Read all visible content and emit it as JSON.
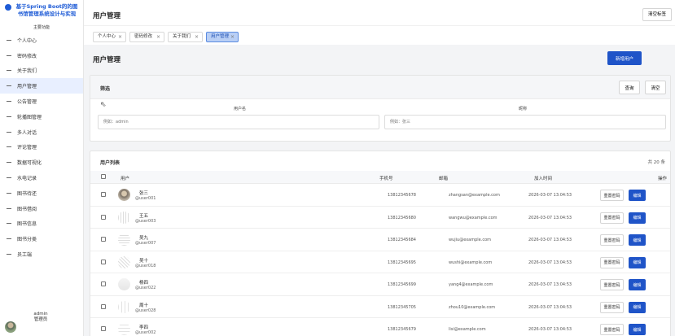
{
  "sidebar": {
    "brand": "基于Spring Boot的的图书馆管理系统设计与实现",
    "section_title": "主要功能",
    "items": [
      {
        "label": "个人中心"
      },
      {
        "label": "密码修改"
      },
      {
        "label": "关于我们"
      },
      {
        "label": "用户管理"
      },
      {
        "label": "公告管理"
      },
      {
        "label": "轮播图管理"
      },
      {
        "label": "多人对话"
      },
      {
        "label": "评论管理"
      },
      {
        "label": "数据可视化"
      },
      {
        "label": "水电记录"
      },
      {
        "label": "图书待还"
      },
      {
        "label": "图书借阅"
      },
      {
        "label": "图书信息"
      },
      {
        "label": "图书分类"
      },
      {
        "label": "员工端"
      }
    ],
    "active_index": 3,
    "user": {
      "name": "admin",
      "role": "管理员"
    }
  },
  "topbar": {
    "title": "用户管理",
    "close_tabs_label": "清空标签"
  },
  "tabs": [
    {
      "label": "个人中心",
      "close": "×"
    },
    {
      "label": "密码修改",
      "close": "×"
    },
    {
      "label": "关于我们",
      "close": "×"
    },
    {
      "label": "用户管理",
      "close": "×"
    }
  ],
  "main": {
    "heading": "用户管理",
    "new_user_label": "新增用户"
  },
  "filter": {
    "title": "筛选",
    "search_label": "查询",
    "clear_label": "清空",
    "username_label": "用户名",
    "username_placeholder": "例如：admin",
    "nickname_label": "昵称",
    "nickname_placeholder": "例如：张三"
  },
  "table": {
    "title": "用户列表",
    "count": "共 20 条",
    "columns": {
      "user": "用户",
      "phone": "手机号",
      "email": "邮箱",
      "created": "加入时间",
      "actions": "操作"
    },
    "reset_label": "重置密码",
    "edit_label": "编辑",
    "rows": [
      {
        "name": "张三",
        "uid": "@user001",
        "phone": "13812345678",
        "email": "zhangsan@example.com",
        "time": "2026-03-07 13:04:53"
      },
      {
        "name": "王五",
        "uid": "@user003",
        "phone": "13812345680",
        "email": "wangwu@example.com",
        "time": "2026-03-07 13:04:53"
      },
      {
        "name": "吴九",
        "uid": "@user007",
        "phone": "13812345684",
        "email": "wujiu@example.com",
        "time": "2026-03-07 13:04:53"
      },
      {
        "name": "吴十",
        "uid": "@user018",
        "phone": "13812345695",
        "email": "wushi@example.com",
        "time": "2026-03-07 13:04:53"
      },
      {
        "name": "杨四",
        "uid": "@user022",
        "phone": "13812345699",
        "email": "yang4@example.com",
        "time": "2026-03-07 13:04:53"
      },
      {
        "name": "周十",
        "uid": "@user028",
        "phone": "13812345705",
        "email": "zhou10@example.com",
        "time": "2026-03-07 13:04:53"
      },
      {
        "name": "李四",
        "uid": "@user002",
        "phone": "13812345679",
        "email": "lisi@example.com",
        "time": "2026-03-07 13:04:53"
      }
    ]
  }
}
